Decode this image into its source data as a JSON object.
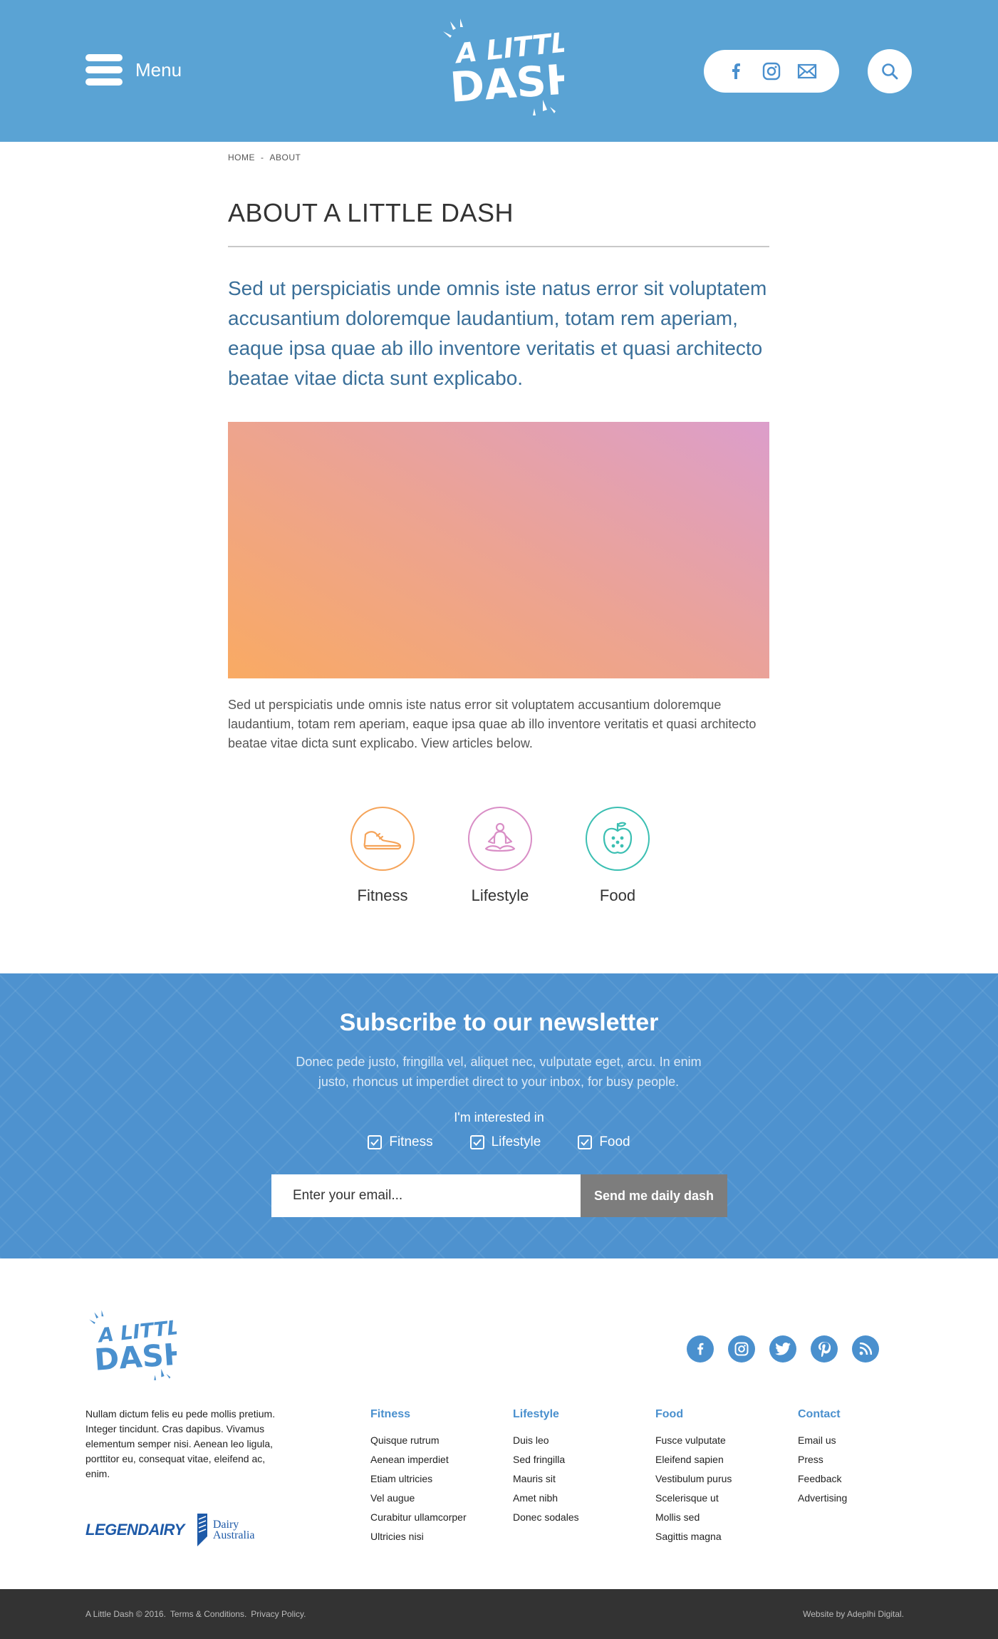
{
  "header": {
    "menu_label": "Menu",
    "logo_line1": "A LITTLE",
    "logo_line2": "DASH",
    "social_icons": [
      "facebook-icon",
      "instagram-icon",
      "email-icon"
    ],
    "search_icon": "search-icon"
  },
  "breadcrumb": {
    "home": "HOME",
    "separator": "-",
    "current": "ABOUT"
  },
  "main": {
    "title": "ABOUT A LITTLE DASH",
    "lead": "Sed ut perspiciatis unde omnis iste natus error sit voluptatem accusantium doloremque laudantium, totam rem aperiam, eaque ipsa quae ab illo inventore veritatis et quasi architecto beatae vitae dicta sunt explicabo.",
    "body": "Sed ut perspiciatis unde omnis iste natus error sit voluptatem accusantium doloremque laudantium, totam rem aperiam, eaque ipsa quae ab illo inventore veritatis et quasi architecto beatae vitae dicta sunt explicabo. View articles below.",
    "hero_gradient": [
      "#f9aa63",
      "#dc9ecb"
    ]
  },
  "categories": [
    {
      "label": "Fitness",
      "icon": "shoe-icon",
      "color": "#f5a45a"
    },
    {
      "label": "Lifestyle",
      "icon": "meditation-icon",
      "color": "#d98ec6"
    },
    {
      "label": "Food",
      "icon": "apple-icon",
      "color": "#3bbfb2"
    }
  ],
  "newsletter": {
    "title": "Subscribe to our newsletter",
    "description": "Donec pede justo, fringilla vel, aliquet nec, vulputate eget, arcu. In enim justo, rhoncus ut imperdiet direct to your inbox, for busy people.",
    "interest_label": "I'm interested in",
    "options": [
      {
        "label": "Fitness",
        "checked": true
      },
      {
        "label": "Lifestyle",
        "checked": true
      },
      {
        "label": "Food",
        "checked": true
      }
    ],
    "email_placeholder": "Enter your email...",
    "submit_label": "Send me daily dash"
  },
  "footer": {
    "blurb": "Nullam dictum felis eu pede mollis pretium. Integer tincidunt. Cras dapibus. Vivamus elementum semper nisi. Aenean leo ligula, porttitor eu, consequat vitae, eleifend ac, enim.",
    "partner1": "LEGENDAIRY",
    "partner2_line1": "Dairy",
    "partner2_line2": "Australia",
    "social_icons": [
      "facebook-icon",
      "instagram-icon",
      "twitter-icon",
      "pinterest-icon",
      "rss-icon"
    ],
    "columns": [
      {
        "heading": "Fitness",
        "links": [
          "Quisque rutrum",
          "Aenean imperdiet",
          "Etiam ultricies",
          "Vel augue",
          "Curabitur ullamcorper",
          "Ultricies nisi"
        ]
      },
      {
        "heading": "Lifestyle",
        "links": [
          "Duis leo",
          "Sed fringilla",
          "Mauris sit",
          "Amet nibh",
          "Donec sodales"
        ]
      },
      {
        "heading": "Food",
        "links": [
          "Fusce vulputate",
          "Eleifend sapien",
          "Vestibulum purus",
          "Scelerisque ut",
          "Mollis sed",
          "Sagittis magna"
        ]
      },
      {
        "heading": "Contact",
        "links": [
          "Email us",
          "Press",
          "Feedback",
          "Advertising"
        ]
      }
    ],
    "copyright": "A Little Dash © 2016.",
    "terms": "Terms & Conditions.",
    "privacy": "Privacy Policy.",
    "credit": "Website by Adeplhi Digital."
  },
  "colors": {
    "header_blue": "#5aa3d4",
    "newsletter_blue": "#4e92cf",
    "lead_text": "#3a6f99",
    "footer_bar": "#333333"
  }
}
